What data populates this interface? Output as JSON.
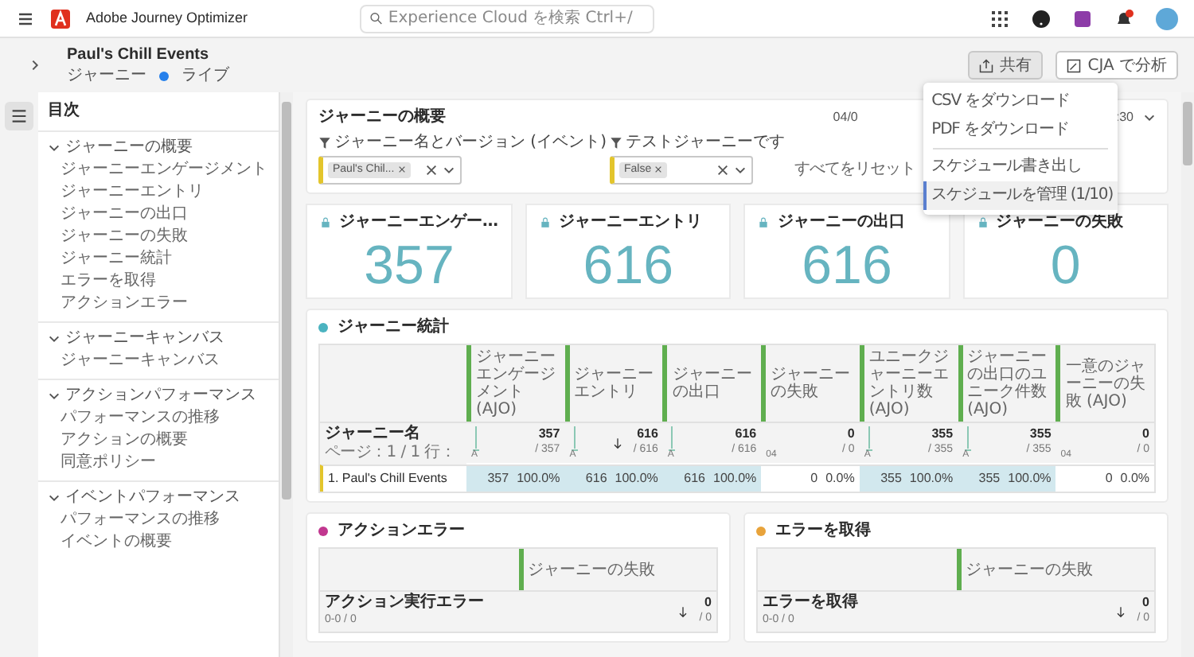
{
  "app": {
    "name": "Adobe Journey Optimizer",
    "search_placeholder": "Experience Cloud を検索 Ctrl+/"
  },
  "header": {
    "title": "Paul's Chill Events",
    "type": "ジャーニー",
    "status": "ライブ",
    "buttons": [
      {
        "kind": "share",
        "label": "共有",
        "selected": true
      },
      {
        "kind": "analyze",
        "label": "CJA で分析",
        "selected": false
      }
    ]
  },
  "menu": {
    "items": [
      {
        "label": "CSV をダウンロード",
        "hovered": false,
        "divider_after": false
      },
      {
        "label": "PDF をダウンロード",
        "hovered": false,
        "divider_after": true
      },
      {
        "label": "スケジュール書き出し",
        "hovered": false,
        "divider_after": false
      },
      {
        "label": "スケジュールを管理 (1/10)",
        "hovered": true,
        "divider_after": false
      }
    ]
  },
  "sidebar": {
    "title": "目次",
    "sections": [
      {
        "label": "ジャーニーの概要",
        "expanded": true,
        "items": [
          "ジャーニーエンゲージメント",
          "ジャーニーエントリ",
          "ジャーニーの出口",
          "ジャーニーの失敗",
          "ジャーニー統計",
          "エラーを取得",
          "アクションエラー"
        ]
      },
      {
        "label": "ジャーニーキャンバス",
        "expanded": true,
        "items": [
          "ジャーニーキャンバス"
        ]
      },
      {
        "label": "アクションパフォーマンス",
        "expanded": true,
        "items": [
          "パフォーマンスの推移",
          "アクションの概要",
          "同意ポリシー"
        ]
      },
      {
        "label": "イベントパフォーマンス",
        "expanded": true,
        "items": [
          "パフォーマンスの推移",
          "イベントの概要"
        ]
      }
    ]
  },
  "overview": {
    "title": "ジャーニーの概要",
    "date_start": "04/0",
    "date_end": ":30",
    "filters": [
      {
        "label": "ジャーニー名とバージョン (イベント)",
        "chip": "Paul's Chil..."
      },
      {
        "label": "テストジャーニーです",
        "chip": "False"
      }
    ],
    "reset": "すべてをリセット",
    "cards": [
      {
        "title": "ジャーニーエンゲー…",
        "value": "357"
      },
      {
        "title": "ジャーニーエントリ",
        "value": "616"
      },
      {
        "title": "ジャーニーの出口",
        "value": "616"
      },
      {
        "title": "ジャーニーの失敗",
        "value": "0"
      }
    ]
  },
  "stats": {
    "title": "ジャーニー統計",
    "row_header": "ジャーニー名",
    "pager": "ページ：1 / 1 行：",
    "columns": [
      {
        "label": "ジャーニーエンゲージメント (AJO)",
        "total": "357",
        "of": "/ 357",
        "axis": "A",
        "sorted": false
      },
      {
        "label": "ジャーニーエントリ",
        "total": "616",
        "of": "/ 616",
        "axis": "A",
        "sorted": true
      },
      {
        "label": "ジャーニーの出口",
        "total": "616",
        "of": "/ 616",
        "axis": "A",
        "sorted": false
      },
      {
        "label": "ジャーニーの失敗",
        "total": "0",
        "of": "/ 0",
        "axis": "04",
        "sorted": false
      },
      {
        "label": "ユニークジャーニーエントリ数 (AJO)",
        "total": "355",
        "of": "/ 355",
        "axis": "A",
        "sorted": false
      },
      {
        "label": "ジャーニーの出口のユニーク件数 (AJO)",
        "total": "355",
        "of": "/ 355",
        "axis": "A",
        "sorted": false
      },
      {
        "label": "一意のジャーニーの失敗 (AJO)",
        "total": "0",
        "of": "/ 0",
        "axis": "04",
        "sorted": false
      }
    ],
    "rows": [
      {
        "name": "1.  Paul's Chill Events",
        "cells": [
          {
            "value": "357",
            "pct": "100.0%",
            "highlighted": true
          },
          {
            "value": "616",
            "pct": "100.0%",
            "highlighted": true
          },
          {
            "value": "616",
            "pct": "100.0%",
            "highlighted": true
          },
          {
            "value": "0",
            "pct": "0.0%",
            "highlighted": false
          },
          {
            "value": "355",
            "pct": "100.0%",
            "highlighted": true
          },
          {
            "value": "355",
            "pct": "100.0%",
            "highlighted": true
          },
          {
            "value": "0",
            "pct": "0.0%",
            "highlighted": false
          }
        ]
      }
    ]
  },
  "error_panels": [
    {
      "title": "アクションエラー",
      "color": "#c1378f",
      "column": "ジャーニーの失敗",
      "row_header": "アクション実行エラー",
      "pager": "0-0 / 0",
      "total": "0",
      "of": "/ 0"
    },
    {
      "title": "エラーを取得",
      "color": "#e8a33b",
      "column": "ジャーニーの失敗",
      "row_header": "エラーを取得",
      "pager": "0-0 / 0",
      "total": "0",
      "of": "/ 0"
    }
  ]
}
